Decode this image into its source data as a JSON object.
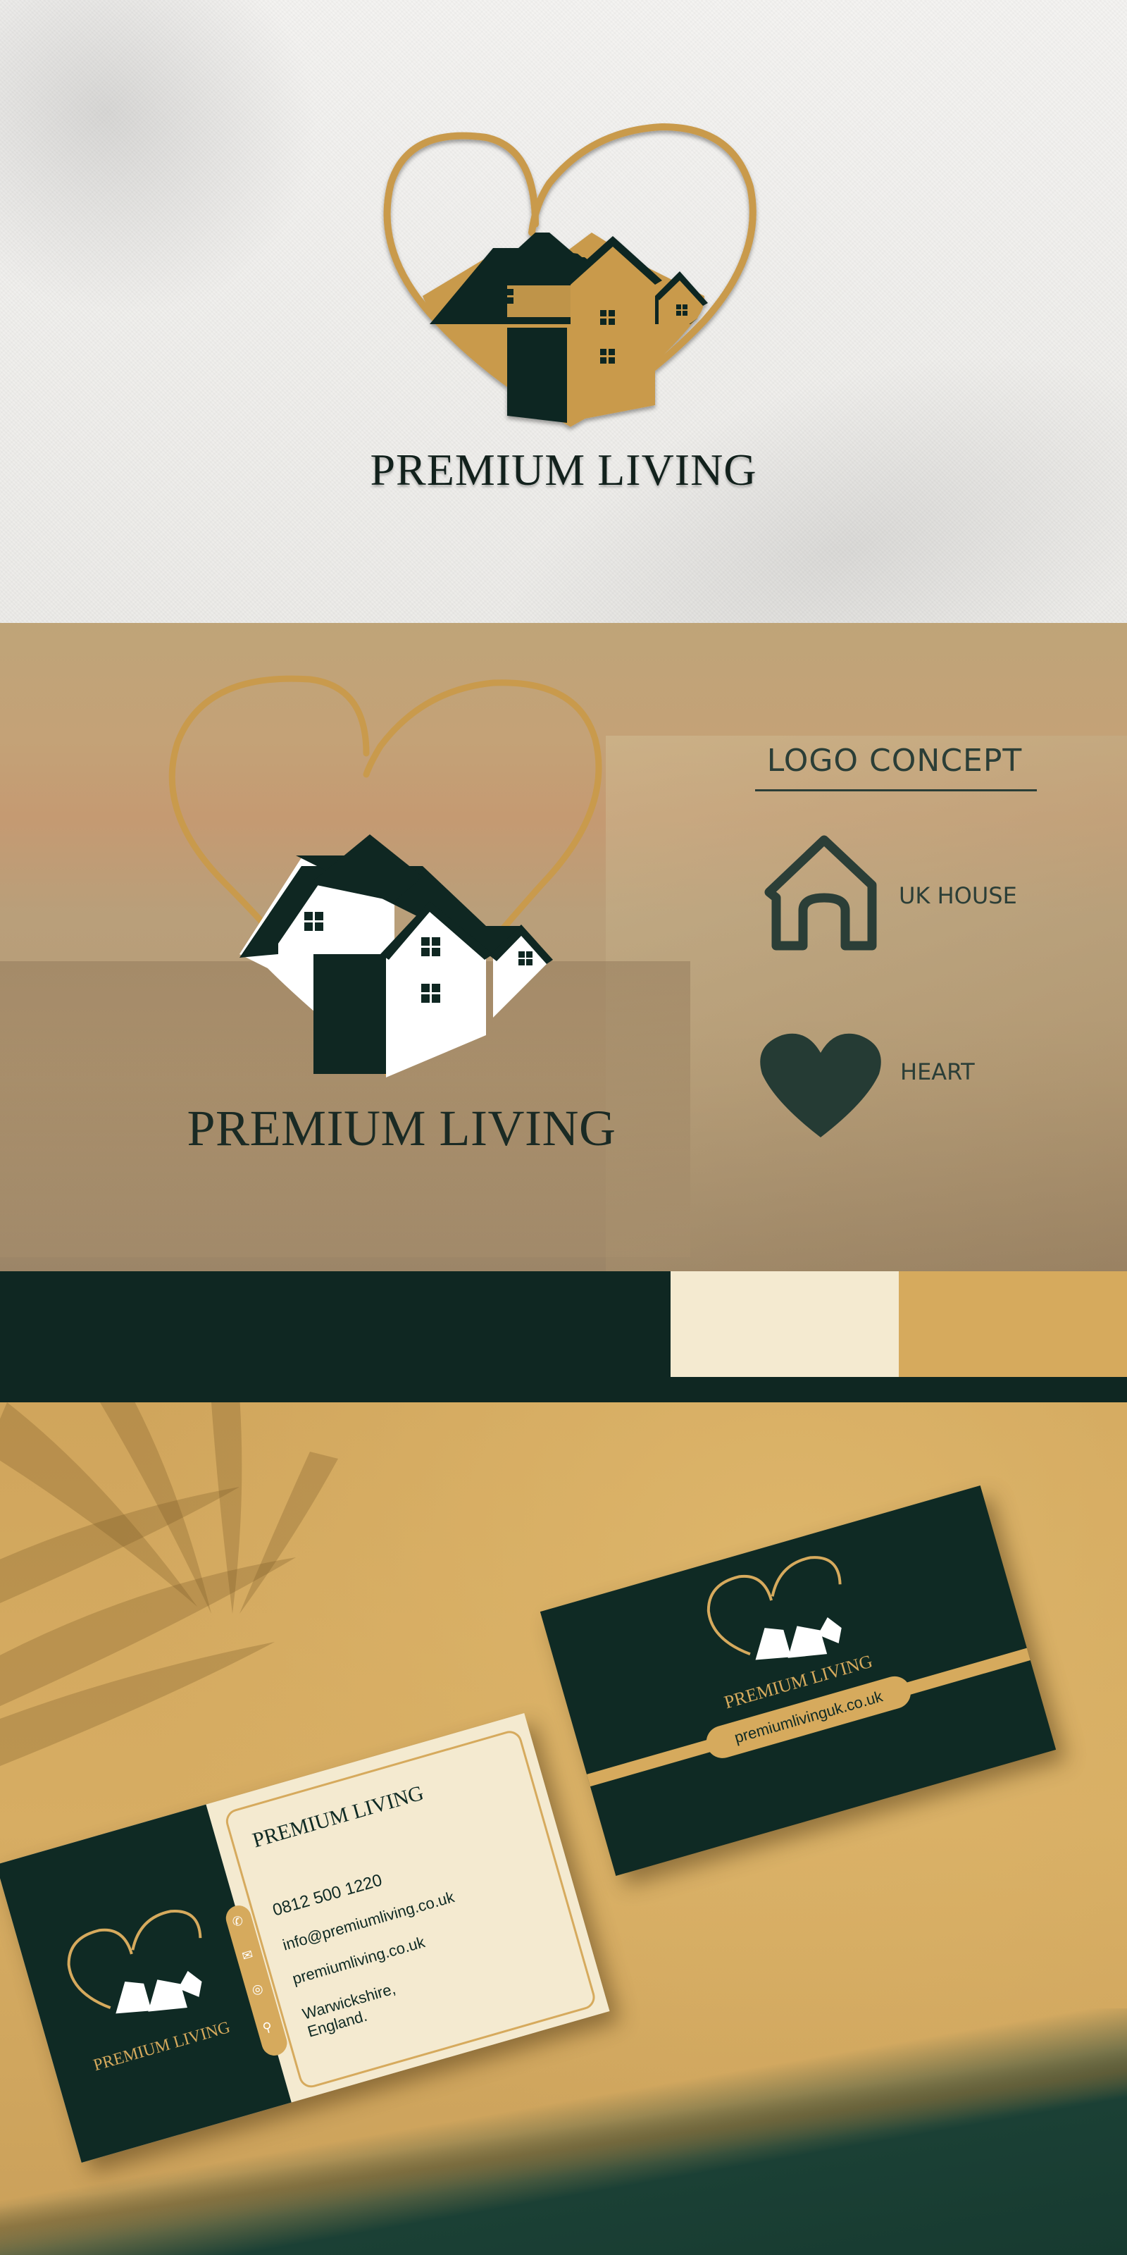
{
  "brand": {
    "name": "PREMIUM LIVING",
    "colors": {
      "dark_green": "#0f2722",
      "gold": "#d6aa5d",
      "cream": "#f4ead0",
      "white": "#ffffff"
    }
  },
  "mockup_embossed": {
    "title": "PREMIUM LIVING"
  },
  "concept_panel": {
    "logo_title": "PREMIUM LIVING",
    "heading": "LOGO CONCEPT",
    "items": [
      {
        "icon": "house-outline-icon",
        "label": "UK HOUSE"
      },
      {
        "icon": "heart-icon",
        "label": "HEART"
      }
    ]
  },
  "palette": {
    "swatches": [
      "#0f2722",
      "#f4ead0",
      "#d6aa5d"
    ]
  },
  "business_card_front": {
    "brand": "PREMIUM LIVING",
    "phone": "0812 500 1220",
    "email": "info@premiumliving.co.uk",
    "website": "premiumliving.co.uk",
    "address_line1": "Warwickshire,",
    "address_line2": "England.",
    "contact_icons": [
      "phone-icon",
      "email-icon",
      "globe-icon",
      "location-pin-icon"
    ],
    "logo_text": "PREMIUM LIVING"
  },
  "business_card_back": {
    "brand": "PREMIUM LIVING",
    "website": "premiumlivinguk.co.uk"
  }
}
